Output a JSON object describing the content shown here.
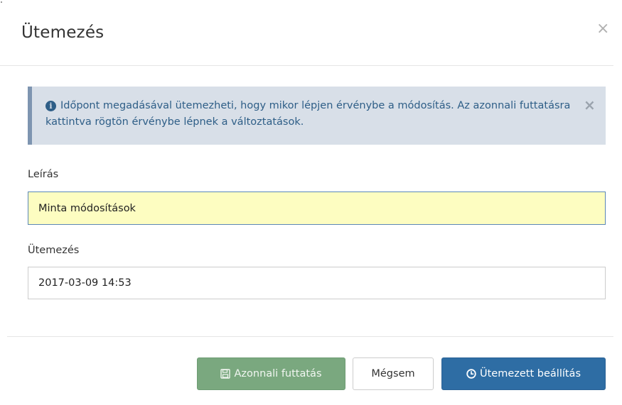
{
  "dialog": {
    "title": "Ütemezés",
    "close_glyph": "×"
  },
  "alert": {
    "icon": "info-circle-icon",
    "message": "Időpont megadásával ütemezheti, hogy mikor lépjen érvénybe a módosítás. Az azonnali futtatásra kattintva rögtön érvénybe lépnek a változtatások.",
    "close_glyph": "×"
  },
  "form": {
    "description": {
      "label": "Leírás",
      "value": "Minta módosítások"
    },
    "schedule": {
      "label": "Ütemezés",
      "value": "2017-03-09 14:53"
    }
  },
  "footer": {
    "run_now": {
      "label": "Azonnali futtatás",
      "icon": "save-icon"
    },
    "cancel": {
      "label": "Mégsem"
    },
    "schedule": {
      "label": "Ütemezett beállítás",
      "icon": "clock-icon"
    }
  },
  "colors": {
    "alert_bg": "#d8dfe8",
    "alert_text": "#2e5e87",
    "highlight_input": "#fdfdc1",
    "success_button": "#7aa87f",
    "primary_button": "#2e6da4"
  }
}
